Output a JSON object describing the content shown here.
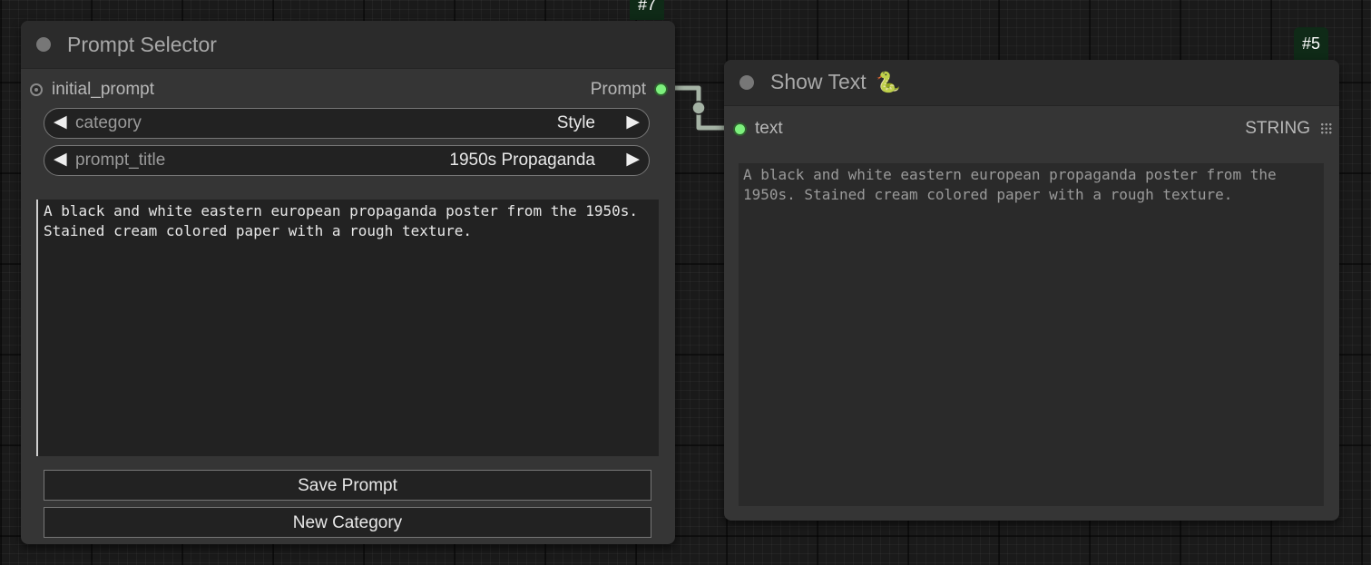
{
  "canvas": {
    "background": "#1a1a1a",
    "link_color": "#a5b3a5"
  },
  "nodes": {
    "prompt_selector": {
      "badge": "#7",
      "title": "Prompt Selector",
      "input_label": "initial_prompt",
      "output_label": "Prompt",
      "widgets": {
        "category": {
          "label": "category",
          "value": "Style"
        },
        "prompt_title": {
          "label": "prompt_title",
          "value": "1950s Propaganda"
        }
      },
      "prompt_text": "A black and white eastern european propaganda poster from the 1950s. Stained cream colored paper with a rough texture.",
      "save_label": "Save Prompt",
      "new_category_label": "New Category"
    },
    "show_text": {
      "badge": "#5",
      "title": "Show Text",
      "title_icon": "snake-icon",
      "input_label": "text",
      "input_type": "STRING",
      "output_text": "A black and white eastern european propaganda poster from the 1950s. Stained cream colored paper with a rough texture."
    }
  },
  "colors": {
    "badge": "#0f2a17",
    "slot_connected": "#7df07d",
    "node_body": "#353535",
    "node_title": "#2b2b2b"
  }
}
